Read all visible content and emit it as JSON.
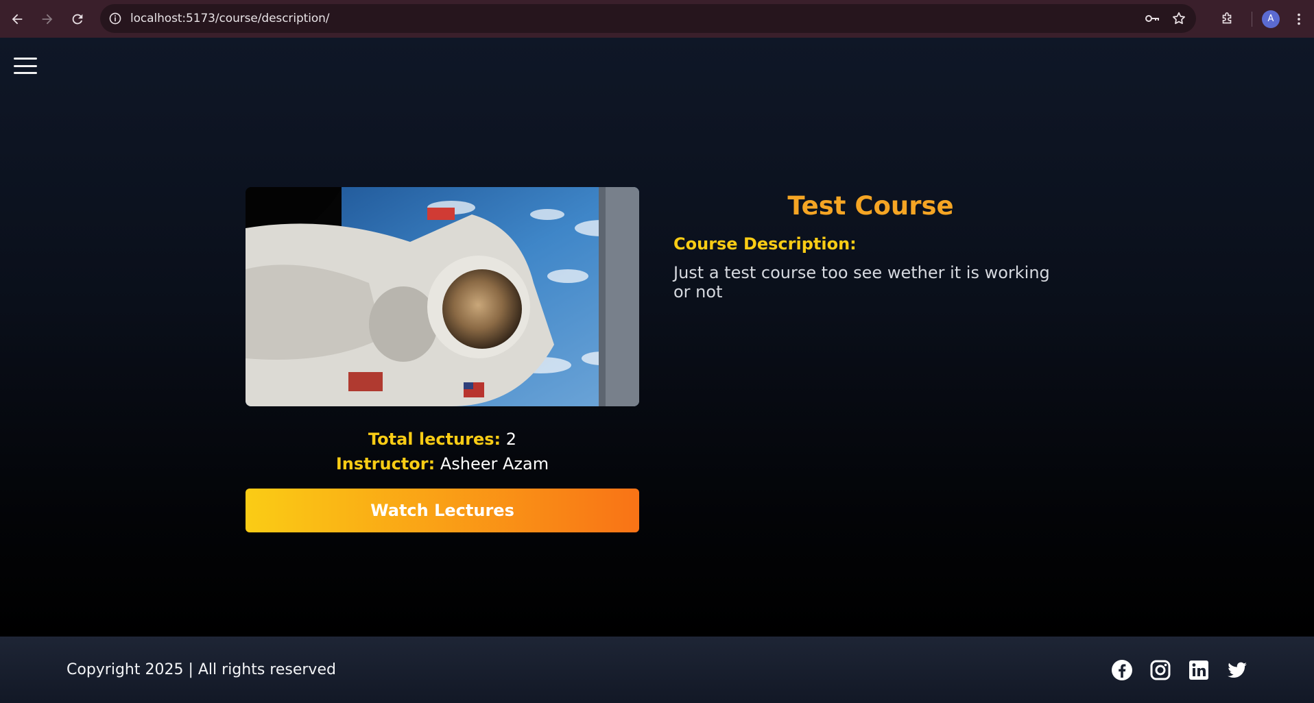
{
  "browser": {
    "url": "localhost:5173/course/description/",
    "profile_initial": "A",
    "icons": [
      "back-icon",
      "forward-icon",
      "reload-icon",
      "site-info-icon",
      "password-key-icon",
      "bookmark-star-icon",
      "extensions-icon",
      "menu-kebab-icon"
    ]
  },
  "page": {
    "menu_icon": "hamburger-icon"
  },
  "course": {
    "title": "Test Course",
    "description_label": "Course Description:",
    "description": "Just a test course too see wether it is working or not",
    "total_lectures_label": "Total lectures:",
    "total_lectures_value": "2",
    "instructor_label": "Instructor:",
    "instructor_value": "Asheer Azam",
    "watch_button": "Watch Lectures",
    "thumbnail": "astronaut-spacewalk-image"
  },
  "footer": {
    "copyright": "Copyright 2025 | All rights reserved",
    "social_icons": [
      "facebook-icon",
      "instagram-icon",
      "linkedin-icon",
      "twitter-icon"
    ]
  },
  "colors": {
    "accent_yellow": "#facc15",
    "accent_orange": "#f97316",
    "title_orange": "#f5a524",
    "chrome_bg": "#3a1f2b"
  }
}
